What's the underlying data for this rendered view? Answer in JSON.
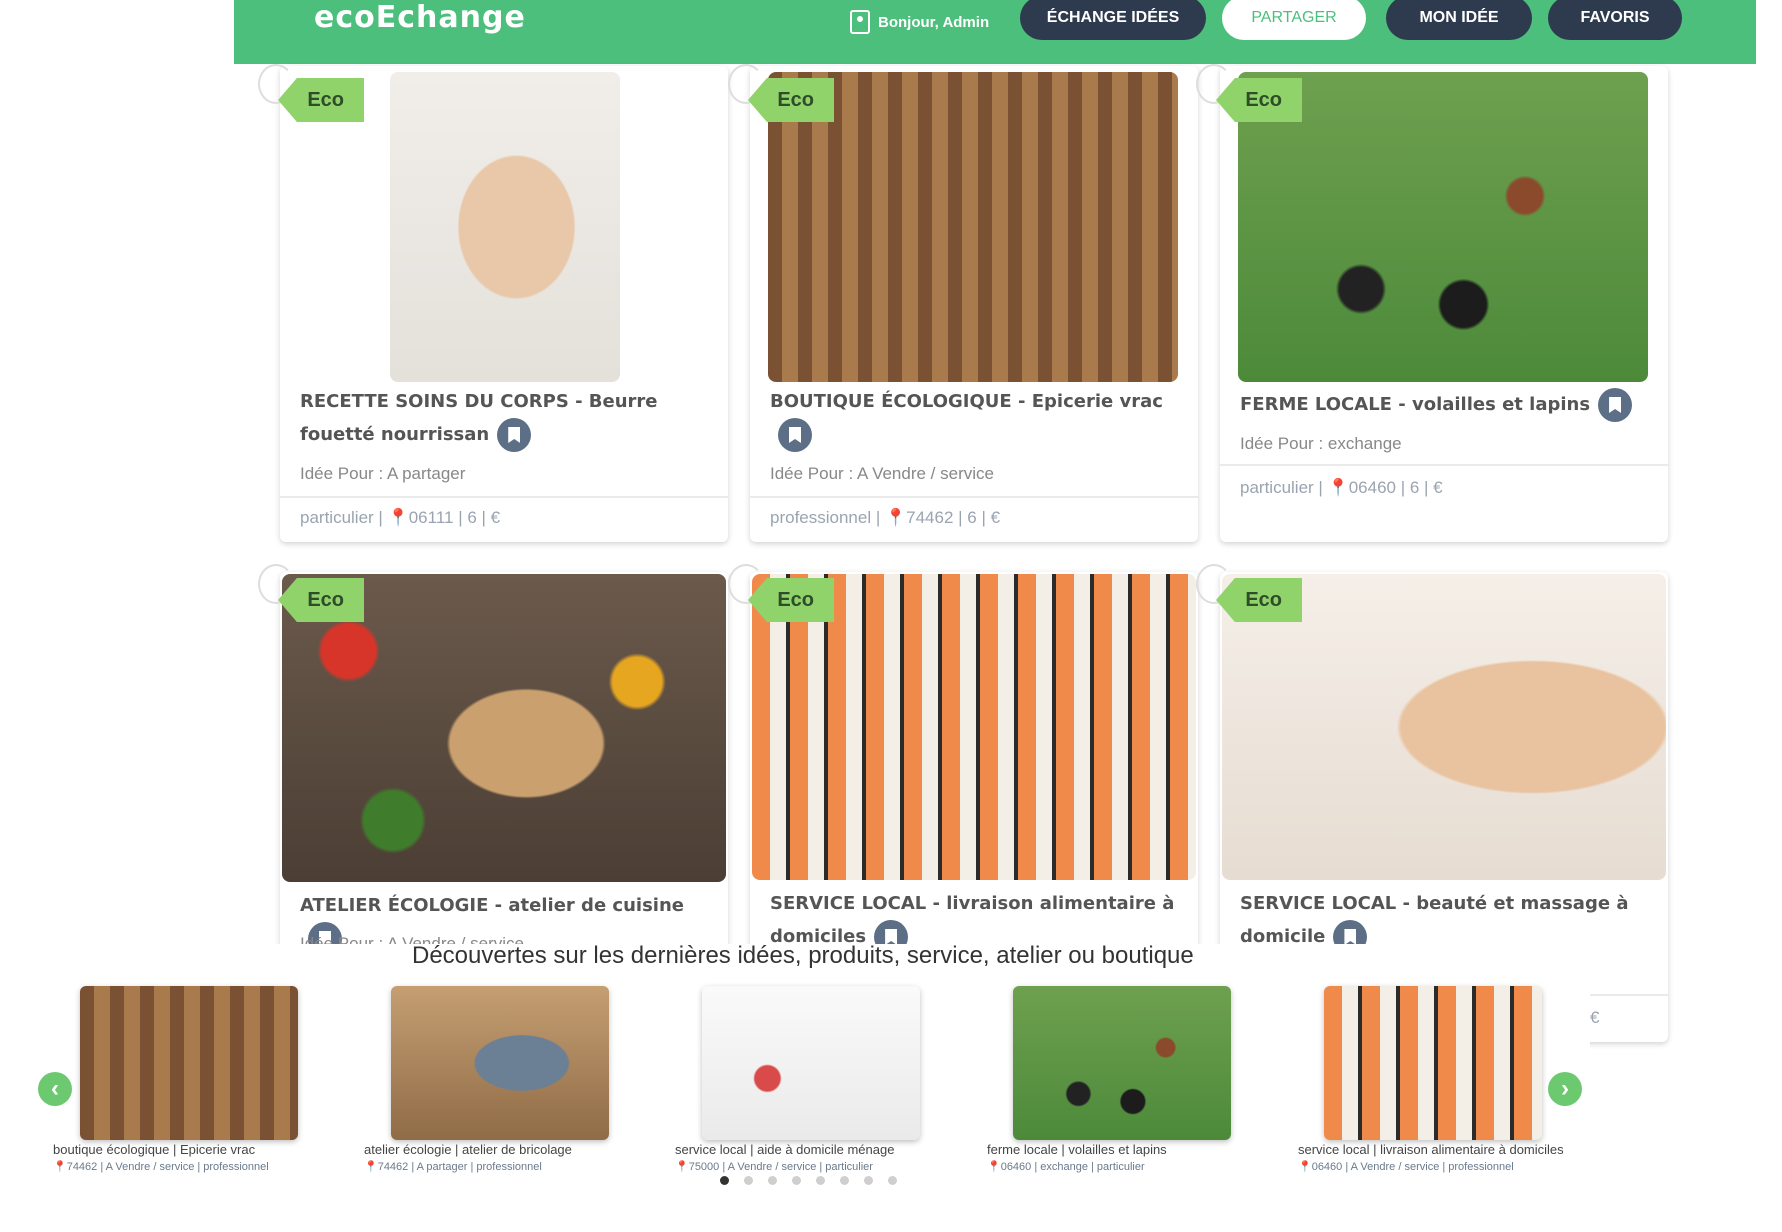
{
  "header": {
    "brand": "ecoEchange",
    "greeting": "Bonjour, Admin",
    "nav": [
      "ÉCHANGE IDÉES",
      "PARTAGER",
      "MON IDÉE",
      "FAVORIS"
    ],
    "active_nav": "PARTAGER"
  },
  "colors": {
    "header_green": "#4cbf7c",
    "nav_dark": "#2e3a4e",
    "tag_green": "#8fd36a",
    "arrow_green": "#6cc970"
  },
  "eco_tag": "Eco",
  "cards": [
    {
      "title": "RECETTE SOINS DU CORPS - Beurre fouetté nourrissan",
      "idea": "Idée Pour : A partager",
      "meta": "particulier | 📍06111 | 6 | €",
      "image": "hand-cream-photo"
    },
    {
      "title": "BOUTIQUE ÉCOLOGIQUE - Epicerie vrac",
      "idea": "Idée Pour : A Vendre / service",
      "meta": "professionnel | 📍74462 | 6 | €",
      "image": "shop-photo"
    },
    {
      "title": "FERME LOCALE - volailles et lapins",
      "idea": "Idée Pour : exchange",
      "meta": "particulier | 📍06460 | 6 | €",
      "image": "hens-photo"
    },
    {
      "title": "ATELIER ÉCOLOGIE - atelier de cuisine",
      "idea": "Idée Pour : A Vendre / service",
      "meta": "",
      "image": "vegetables-photo"
    },
    {
      "title": "SERVICE LOCAL - livraison alimentaire à domiciles",
      "idea": "",
      "meta": "",
      "image": "sushi-photo"
    },
    {
      "title": "SERVICE LOCAL - beauté et massage à domicile",
      "idea": "",
      "meta": "€",
      "image": "massage-photo"
    }
  ],
  "carousel": {
    "heading": "Découvertes sur les dernières idées, produits, service, atelier ou boutique",
    "slides": [
      {
        "title": "boutique écologique | Epicerie vrac",
        "meta": "📍74462 | A Vendre / service | professionnel",
        "image": "shop-photo"
      },
      {
        "title": "atelier écologie | atelier de bricolage",
        "meta": "📍74462 | A partager | professionnel",
        "image": "tools-photo"
      },
      {
        "title": "service local | aide à domicile ménage",
        "meta": "📍75000 | A Vendre / service | particulier",
        "image": "cleaning-photo"
      },
      {
        "title": "ferme locale | volailles et lapins",
        "meta": "📍06460 | exchange | particulier",
        "image": "hens-photo"
      },
      {
        "title": "service local | livraison alimentaire à domiciles",
        "meta": "📍06460 | A Vendre / service | professionnel",
        "image": "sushi-photo"
      }
    ],
    "prev": "‹",
    "next": "›",
    "dot_count": 8,
    "active_dot": 1
  }
}
